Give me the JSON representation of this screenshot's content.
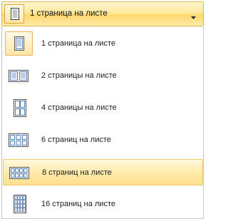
{
  "combo": {
    "selected_label": "1 страница на листе",
    "icon": "one-page-icon",
    "arrow_icon": "dropdown-arrow-icon"
  },
  "options": [
    {
      "label": "1 страница на листе",
      "icon": "one-page-per-sheet-icon",
      "state": "selected"
    },
    {
      "label": "2 страницы на листе",
      "icon": "two-pages-per-sheet-icon",
      "state": "normal"
    },
    {
      "label": "4 страницы на листе",
      "icon": "four-pages-per-sheet-icon",
      "state": "normal"
    },
    {
      "label": "6 страниц на листе",
      "icon": "six-pages-per-sheet-icon",
      "state": "normal"
    },
    {
      "label": "8 страниц на листе",
      "icon": "eight-pages-per-sheet-icon",
      "state": "hover"
    },
    {
      "label": "16 страниц на листе",
      "icon": "sixteen-pages-per-sheet-icon",
      "state": "normal"
    }
  ],
  "colors": {
    "highlight_border": "#efcc72",
    "highlight_fill": "#ffe9a6",
    "icon_blue": "#5a7fb4"
  }
}
